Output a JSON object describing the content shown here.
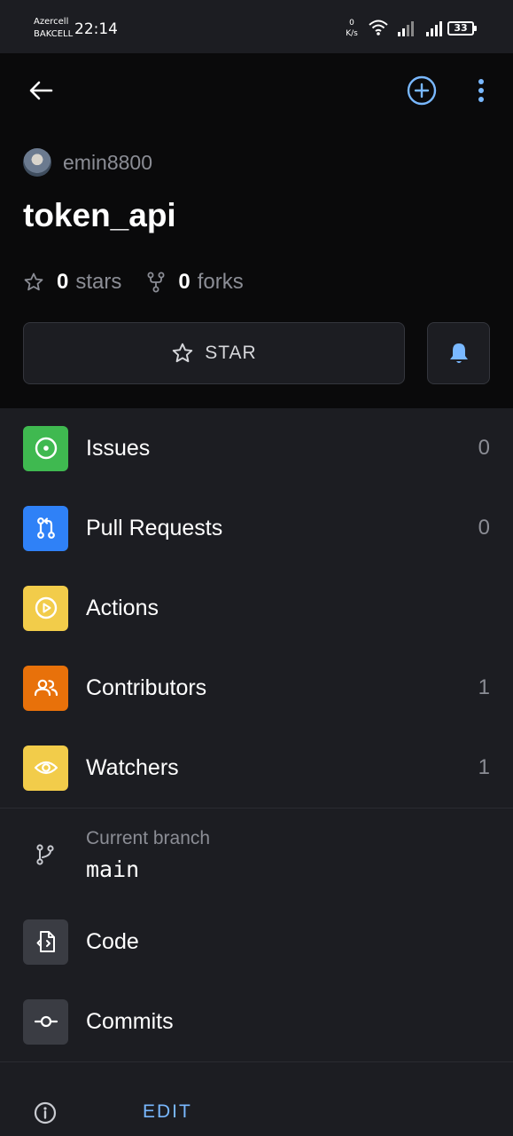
{
  "status_bar": {
    "carrier_1": "Azercell",
    "carrier_2": "BAKCELL",
    "time": "22:14",
    "net_speed_value": "0",
    "net_speed_unit": "K/s",
    "battery": "33"
  },
  "header": {
    "owner": "emin8800",
    "repo_name": "token_api",
    "stars_count": "0",
    "stars_label": "stars",
    "forks_count": "0",
    "forks_label": "forks",
    "star_button_label": "STAR"
  },
  "menu": {
    "items": [
      {
        "label": "Issues",
        "count": "0",
        "color": "#3fb950",
        "icon": "issue-icon"
      },
      {
        "label": "Pull Requests",
        "count": "0",
        "color": "#2f81f7",
        "icon": "pull-request-icon"
      },
      {
        "label": "Actions",
        "count": "",
        "color": "#f2cc4a",
        "icon": "play-icon"
      },
      {
        "label": "Contributors",
        "count": "1",
        "color": "#e8710a",
        "icon": "people-icon"
      },
      {
        "label": "Watchers",
        "count": "1",
        "color": "#f2cc4a",
        "icon": "eye-icon"
      }
    ]
  },
  "branch": {
    "label": "Current branch",
    "name": "main"
  },
  "code": {
    "items": [
      {
        "label": "Code",
        "icon": "code-file-icon"
      },
      {
        "label": "Commits",
        "icon": "commit-icon"
      }
    ]
  },
  "footer": {
    "edit_label": "EDIT"
  },
  "colors": {
    "accent": "#79b8ff",
    "header_bg": "#0a0a0b",
    "body_bg": "#1c1d22"
  }
}
